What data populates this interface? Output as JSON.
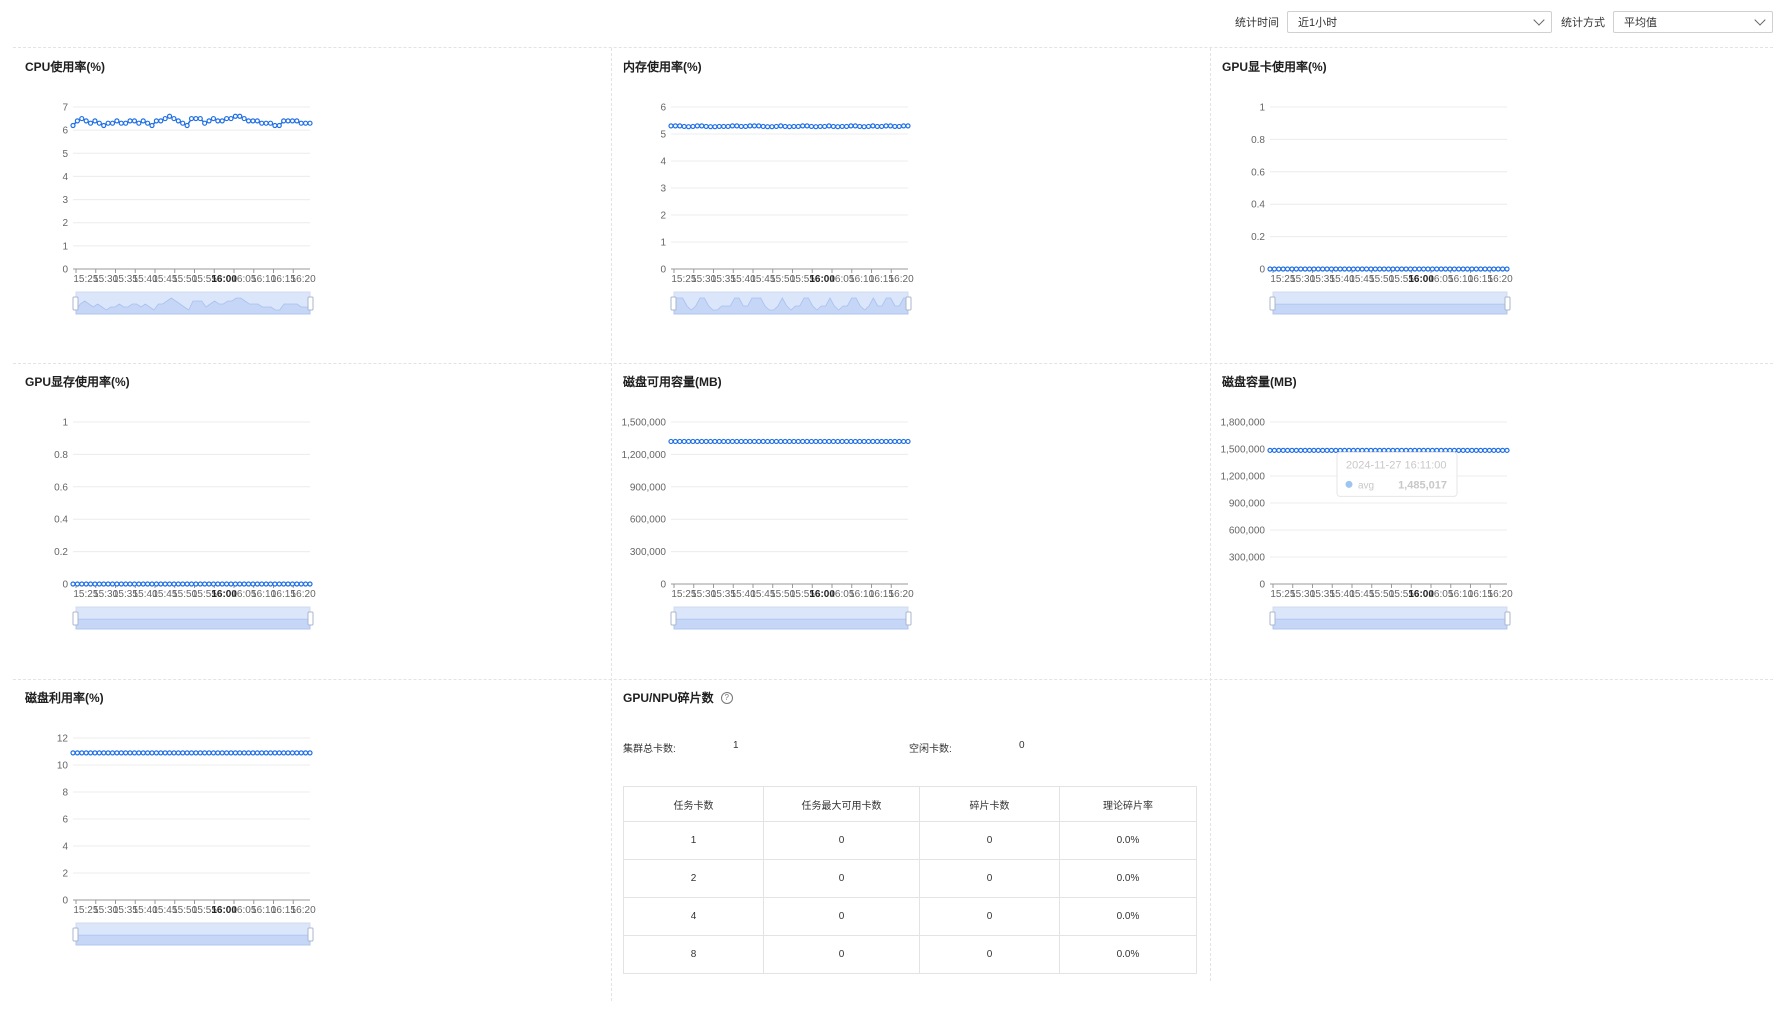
{
  "filters": {
    "time_label": "统计时间",
    "time_value": "近1小时",
    "method_label": "统计方式",
    "method_value": "平均值"
  },
  "colors": {
    "series": "#1f6fe5",
    "grid": "#ececec",
    "slider_fill": "#dbe6fb"
  },
  "time_ticks": [
    "15:25",
    "15:30",
    "15:35",
    "15:40",
    "15:45",
    "15:50",
    "15:55",
    "16:00",
    "16:05",
    "16:10",
    "16:15",
    "16:20"
  ],
  "time_ticks_bold": [
    "16:00"
  ],
  "charts": [
    {
      "title": "CPU使用率(%)",
      "chart_data": {
        "type": "line",
        "series": [
          {
            "name": "avg"
          }
        ],
        "ylim": [
          0,
          7
        ],
        "yticks": [
          "0",
          "1",
          "2",
          "3",
          "4",
          "5",
          "6",
          "7"
        ],
        "values": [
          6.2,
          6.4,
          6.5,
          6.4,
          6.3,
          6.4,
          6.3,
          6.2,
          6.3,
          6.3,
          6.4,
          6.3,
          6.3,
          6.4,
          6.4,
          6.3,
          6.4,
          6.3,
          6.2,
          6.4,
          6.4,
          6.5,
          6.6,
          6.5,
          6.4,
          6.3,
          6.2,
          6.5,
          6.5,
          6.5,
          6.3,
          6.4,
          6.5,
          6.4,
          6.4,
          6.5,
          6.5,
          6.6,
          6.6,
          6.5,
          6.4,
          6.4,
          6.4,
          6.3,
          6.3,
          6.3,
          6.2,
          6.2,
          6.4,
          6.4,
          6.4,
          6.4,
          6.3,
          6.3,
          6.3
        ]
      }
    },
    {
      "title": "内存使用率(%)",
      "chart_data": {
        "type": "line",
        "series": [
          {
            "name": "avg"
          }
        ],
        "ylim": [
          0,
          6
        ],
        "yticks": [
          "0",
          "1",
          "2",
          "3",
          "4",
          "5",
          "6"
        ],
        "values": [
          5.3,
          5.3,
          5.3,
          5.28,
          5.27,
          5.28,
          5.3,
          5.3,
          5.28,
          5.27,
          5.27,
          5.28,
          5.28,
          5.28,
          5.3,
          5.3,
          5.28,
          5.28,
          5.3,
          5.3,
          5.3,
          5.28,
          5.27,
          5.27,
          5.28,
          5.3,
          5.28,
          5.27,
          5.28,
          5.28,
          5.3,
          5.3,
          5.28,
          5.27,
          5.28,
          5.28,
          5.3,
          5.28,
          5.27,
          5.28,
          5.28,
          5.3,
          5.3,
          5.28,
          5.27,
          5.28,
          5.3,
          5.28,
          5.28,
          5.3,
          5.3,
          5.28,
          5.28,
          5.3,
          5.3
        ]
      }
    },
    {
      "title": "GPU显卡使用率(%)",
      "chart_data": {
        "type": "line",
        "series": [
          {
            "name": "avg"
          }
        ],
        "ylim": [
          0,
          1
        ],
        "yticks": [
          "0",
          "0.2",
          "0.4",
          "0.6",
          "0.8",
          "1"
        ],
        "constant": 0,
        "count": 55
      }
    },
    {
      "title": "GPU显存使用率(%)",
      "chart_data": {
        "type": "line",
        "series": [
          {
            "name": "avg"
          }
        ],
        "ylim": [
          0,
          1
        ],
        "yticks": [
          "0",
          "0.2",
          "0.4",
          "0.6",
          "0.8",
          "1"
        ],
        "constant": 0,
        "count": 55
      }
    },
    {
      "title": "磁盘可用容量(MB)",
      "chart_data": {
        "type": "line",
        "series": [
          {
            "name": "avg"
          }
        ],
        "ylim": [
          0,
          1500000
        ],
        "yticks": [
          "0",
          "300,000",
          "600,000",
          "900,000",
          "1,200,000",
          "1,500,000"
        ],
        "constant": 1320000,
        "count": 55
      }
    },
    {
      "title": "磁盘容量(MB)",
      "chart_data": {
        "type": "line",
        "series": [
          {
            "name": "avg"
          }
        ],
        "ylim": [
          0,
          1800000
        ],
        "yticks": [
          "0",
          "300,000",
          "600,000",
          "900,000",
          "1,200,000",
          "1,500,000",
          "1,800,000"
        ],
        "constant": 1485017,
        "count": 55
      },
      "tooltip": {
        "time": "2024-11-27 16:11:00",
        "series": "avg",
        "value": "1,485,017"
      }
    },
    {
      "title": "磁盘利用率(%)",
      "chart_data": {
        "type": "line",
        "series": [
          {
            "name": "avg"
          }
        ],
        "ylim": [
          0,
          12
        ],
        "yticks": [
          "0",
          "2",
          "4",
          "6",
          "8",
          "10",
          "12"
        ],
        "constant": 10.9,
        "count": 55
      }
    }
  ],
  "fragment": {
    "title": "GPU/NPU碎片数",
    "cluster_total_label": "集群总卡数:",
    "cluster_total_value": "1",
    "idle_label": "空闲卡数:",
    "idle_value": "0",
    "headers": [
      "任务卡数",
      "任务最大可用卡数",
      "碎片卡数",
      "理论碎片率"
    ],
    "rows": [
      [
        "1",
        "0",
        "0",
        "0.0%"
      ],
      [
        "2",
        "0",
        "0",
        "0.0%"
      ],
      [
        "4",
        "0",
        "0",
        "0.0%"
      ],
      [
        "8",
        "0",
        "0",
        "0.0%"
      ]
    ]
  }
}
